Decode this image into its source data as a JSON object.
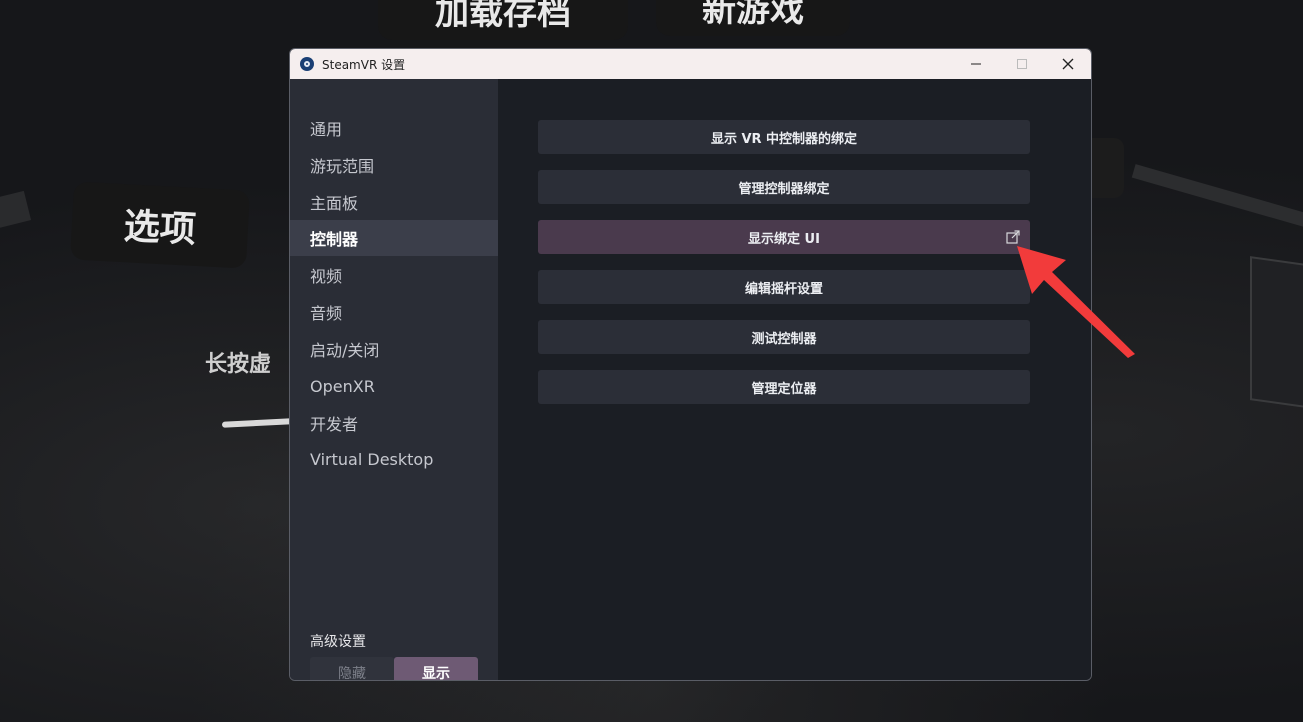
{
  "background": {
    "labels": {
      "load_save": "加载存档",
      "new_game": "新游戏",
      "options": "选项",
      "hold_hint": "长按虚"
    }
  },
  "window": {
    "title": "SteamVR 设置",
    "controls": {
      "minimize_icon": "minimize-icon",
      "maximize_icon": "maximize-icon",
      "close_icon": "close-icon"
    }
  },
  "sidebar": {
    "items": [
      {
        "label": "通用"
      },
      {
        "label": "游玩范围"
      },
      {
        "label": "主面板"
      },
      {
        "label": "控制器",
        "active": true
      },
      {
        "label": "视频"
      },
      {
        "label": "音频"
      },
      {
        "label": "启动/关闭"
      },
      {
        "label": "OpenXR"
      },
      {
        "label": "开发者"
      },
      {
        "label": "Virtual Desktop"
      }
    ],
    "advanced": {
      "label": "高级设置",
      "hide_label": "隐藏",
      "show_label": "显示",
      "selected": "显示"
    }
  },
  "content": {
    "buttons": [
      {
        "label": "显示 VR 中控制器的绑定"
      },
      {
        "label": "管理控制器绑定"
      },
      {
        "label": "显示绑定 UI",
        "highlighted": true,
        "icon": "external-link-icon"
      },
      {
        "label": "编辑摇杆设置"
      },
      {
        "label": "测试控制器"
      },
      {
        "label": "管理定位器"
      }
    ]
  },
  "colors": {
    "sidebar_bg": "#2a2d36",
    "content_bg": "#1b1e24",
    "active_nav": "#3b3e4a",
    "highlight_button": "#4a3a4d",
    "toggle_on": "#6e5a74",
    "arrow": "#f23b3b"
  }
}
